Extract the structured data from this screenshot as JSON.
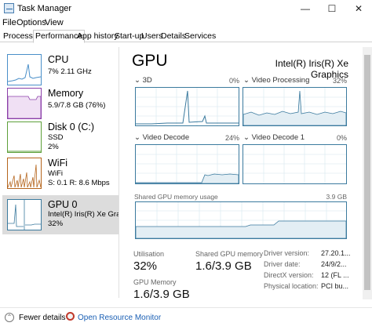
{
  "window": {
    "title": "Task Manager",
    "minimize": "—",
    "maximize": "☐",
    "close": "✕"
  },
  "menu": [
    "File",
    "Options",
    "View"
  ],
  "tabs": [
    "Processes",
    "Performance",
    "App history",
    "Start-up",
    "Users",
    "Details",
    "Services"
  ],
  "active_tab": "Performance",
  "sidebar": {
    "cpu": {
      "name": "CPU",
      "line1": "7%  2.11 GHz"
    },
    "memory": {
      "name": "Memory",
      "line1": "5.9/7.8 GB (76%)"
    },
    "disk": {
      "name": "Disk 0 (C:)",
      "line1": "SSD",
      "line2": "2%"
    },
    "wifi": {
      "name": "WiFi",
      "line1": "WiFi",
      "line2": "S: 0.1  R: 8.6 Mbps"
    },
    "gpu": {
      "name": "GPU 0",
      "line1": "Intel(R) Iris(R) Xe Graph...",
      "line2": "32%"
    }
  },
  "main": {
    "title": "GPU",
    "adapter": "Intel(R) Iris(R) Xe Graphics",
    "engines": [
      {
        "label": "3D",
        "percent": "0%"
      },
      {
        "label": "Video Processing",
        "percent": "32%"
      },
      {
        "label": "Video Decode",
        "percent": "24%"
      },
      {
        "label": "Video Decode 1",
        "percent": "0%"
      }
    ],
    "shared_memory": {
      "label": "Shared GPU memory usage",
      "max": "3.9 GB"
    },
    "stats": {
      "utilisation_label": "Utilisation",
      "utilisation_value": "32%",
      "shared_label": "Shared GPU memory",
      "shared_value": "1.6/3.9 GB",
      "gpu_memory_label": "GPU Memory",
      "gpu_memory_value": "1.6/3.9 GB"
    },
    "details": [
      {
        "key": "Driver version:",
        "value": "27.20.1..."
      },
      {
        "key": "Driver date:",
        "value": "24/9/2..."
      },
      {
        "key": "DirectX version:",
        "value": "12 (FL ..."
      },
      {
        "key": "Physical location:",
        "value": "PCI bu..."
      }
    ]
  },
  "footer": {
    "fewer_details": "Fewer details",
    "resource_monitor": "Open Resource Monitor"
  },
  "colors": {
    "cpu": "#4a8fc9",
    "memory": "#8b3fa8",
    "disk": "#5ea03a",
    "wifi": "#b5651d",
    "gpu": "#3b7a9e"
  }
}
